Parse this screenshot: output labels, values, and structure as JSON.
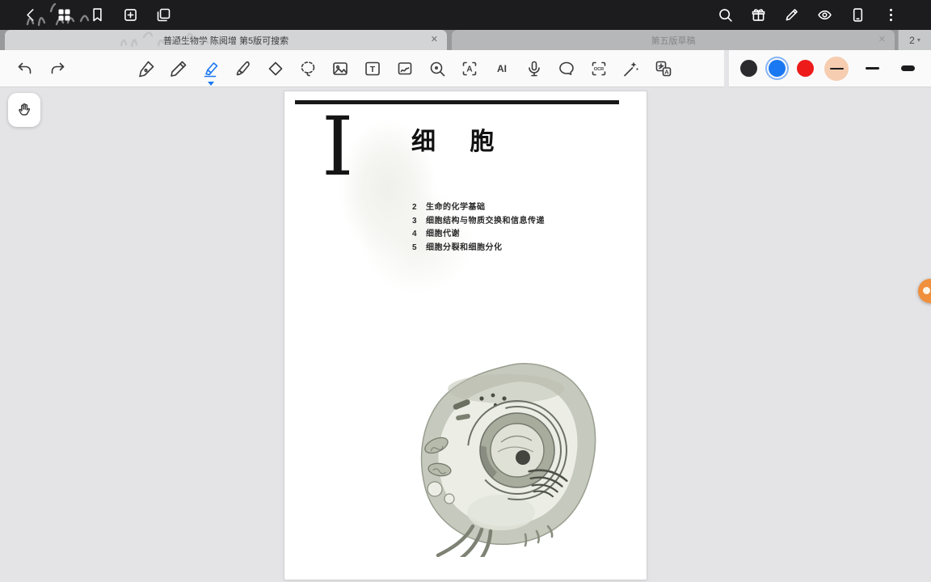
{
  "topbar": {
    "icons": [
      "back",
      "pages-overview",
      "bookmark",
      "add-page",
      "duplicate-page",
      "search",
      "gift",
      "edit-pen",
      "eye-view",
      "device-frame",
      "more-menu"
    ]
  },
  "tabs": {
    "active": {
      "title": "普通生物学 陈阅增 第5版可搜索",
      "close_label": "✕"
    },
    "inactive": {
      "title": "第五版草稿",
      "close_label": "✕"
    },
    "page_indicator": {
      "value": "2",
      "caret": "▾"
    }
  },
  "toolbar": {
    "tools": [
      "undo",
      "redo",
      "fountain-pen",
      "ballpoint-pen",
      "highlighter",
      "brush-pen",
      "eraser",
      "lasso",
      "image",
      "text",
      "shape",
      "magnifier",
      "text-recognition",
      "ai",
      "microphone",
      "comment",
      "ocr",
      "laser-pointer",
      "translate"
    ],
    "selected_tool": "highlighter",
    "labels": {
      "text_tool": "T",
      "text_recognition": "A",
      "ai": "AI",
      "ocr": "OCR",
      "translate": "A"
    },
    "colors": [
      {
        "name": "black",
        "hex": "#2b2b2d",
        "selected": false
      },
      {
        "name": "blue",
        "hex": "#1a78f2",
        "selected": true
      },
      {
        "name": "red",
        "hex": "#ee1b1b",
        "selected": false
      }
    ],
    "thickness": {
      "options": [
        "thin",
        "medium",
        "thick"
      ],
      "selected": "thin",
      "selected_swatch_bg": "#f6cdb0"
    }
  },
  "page": {
    "part_number": "I",
    "title": "细 胞",
    "toc": [
      {
        "num": "2",
        "label": "生命的化学基础"
      },
      {
        "num": "3",
        "label": "细胞结构与物质交换和信息传递"
      },
      {
        "num": "4",
        "label": "细胞代谢"
      },
      {
        "num": "5",
        "label": "细胞分裂和细胞分化"
      }
    ]
  },
  "floating": {
    "record_button_color": "#f08f3c"
  }
}
